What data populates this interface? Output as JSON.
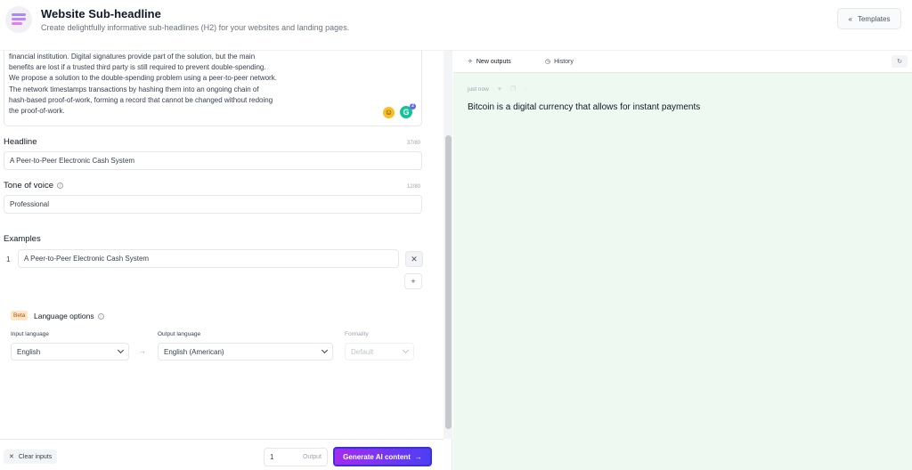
{
  "header": {
    "title": "Website Sub-headline",
    "subtitle": "Create delightfully informative sub-headlines (H2) for your websites and landing pages.",
    "templates_label": "Templates"
  },
  "description": {
    "text": "financial institution. Digital signatures provide part of the solution, but the main\nbenefits are lost if a trusted third party is still required to prevent double-spending.\nWe propose a solution to the double-spending problem using a peer-to-peer network.\nThe network timestamps transactions by hashing them into an ongoing chain of\nhash-based proof-of-work, forming a record that cannot be changed without redoing\nthe proof-of-work.",
    "grammarly_count": "2"
  },
  "headline": {
    "label": "Headline",
    "counter": "37/80",
    "value": "A Peer-to-Peer Electronic Cash System"
  },
  "tone": {
    "label": "Tone of voice",
    "counter": "12/80",
    "value": "Professional"
  },
  "examples": {
    "label": "Examples",
    "items": [
      {
        "num": "1",
        "value": "A Peer-to-Peer Electronic Cash System"
      }
    ]
  },
  "language": {
    "beta": "Beta",
    "title": "Language options",
    "input_label": "Input language",
    "input_value": "English",
    "output_label": "Output language",
    "output_value": "English (American)",
    "formality_label": "Formality",
    "formality_value": "Default",
    "arrow": "→"
  },
  "footer": {
    "clear_label": "Clear inputs",
    "output_count": "1",
    "output_label": "Output",
    "generate_label": "Generate AI content"
  },
  "right": {
    "tab_new": "New outputs",
    "tab_history": "History",
    "timestamp": "just now",
    "result": "Bitcoin is a digital currency that allows for instant payments"
  },
  "colors": {
    "accent_start": "#a32cf0",
    "accent_end": "#4d3ef2",
    "output_bg": "#eefaf1"
  }
}
